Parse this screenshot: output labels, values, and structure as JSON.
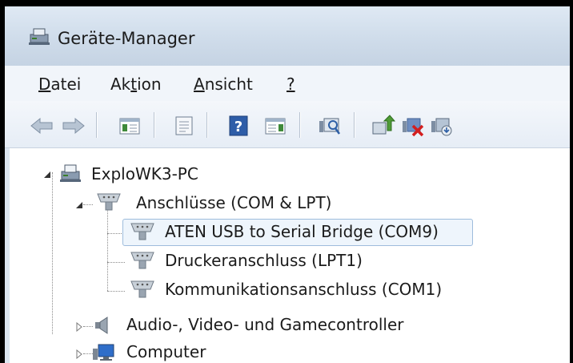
{
  "window": {
    "title": "Geräte-Manager"
  },
  "menu": [
    {
      "label": "Datei"
    },
    {
      "label": "Aktion"
    },
    {
      "label": "Ansicht"
    },
    {
      "label": "?"
    }
  ],
  "toolbar": {
    "buttons": [
      "back-arrow-icon",
      "forward-arrow-icon",
      "show-hide-console-tree-icon",
      "properties-icon",
      "help-icon",
      "action-pane-icon",
      "scan-hardware-icon",
      "update-driver-icon",
      "uninstall-device-icon",
      "disable-device-icon"
    ]
  },
  "tree": {
    "root": {
      "label": "ExploWK3-PC"
    },
    "ports": {
      "label": "Anschlüsse (COM & LPT)"
    },
    "port_items": [
      {
        "label": "ATEN USB to Serial Bridge (COM9)"
      },
      {
        "label": "Druckeranschluss (LPT1)"
      },
      {
        "label": "Kommunikationsanschluss (COM1)"
      }
    ],
    "audio": {
      "label": "Audio-, Video- und Gamecontroller"
    },
    "computer": {
      "label": "Computer"
    }
  }
}
